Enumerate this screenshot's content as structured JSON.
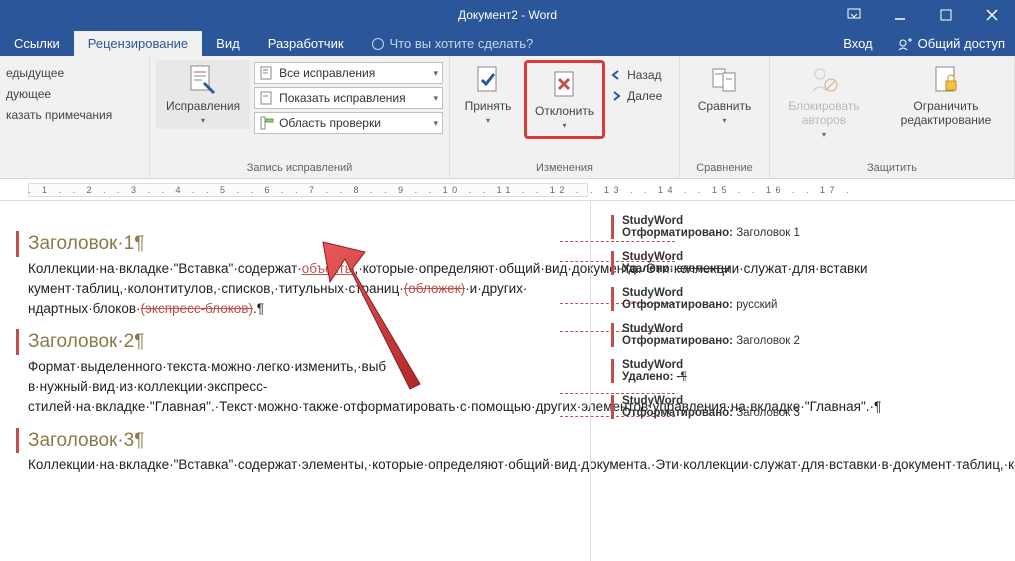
{
  "title": "Документ2 - Word",
  "tabs": {
    "references": "Ссылки",
    "review": "Рецензирование",
    "view": "Вид",
    "developer": "Разработчик",
    "tellme": "Что вы хотите сделать?",
    "login": "Вход",
    "share": "Общий доступ"
  },
  "ribbon": {
    "nav": {
      "prev": "едыдущее",
      "next": "дующее",
      "show_comments": "казать примечания"
    },
    "track": {
      "button": "Исправления",
      "display": "Все исправления",
      "show": "Показать исправления",
      "area": "Область проверки",
      "group": "Запись исправлений"
    },
    "changes": {
      "accept": "Принять",
      "reject": "Отклонить",
      "back": "Назад",
      "forward": "Далее",
      "group": "Изменения"
    },
    "compare": {
      "button": "Сравнить",
      "group": "Сравнение"
    },
    "protect": {
      "block": "Блокировать авторов",
      "restrict": "Ограничить редактирование",
      "group": "Защитить"
    }
  },
  "ruler": ". 1 . . 2 . . 3 . . 4 . . 5 . . 6 . . 7 . . 8 . . 9 . . 10 . . 11 . . 12 . . 13 . . 14 .   . 15 . . 16 . . 17 .",
  "doc": {
    "h1": "Заголовок·1¶",
    "p1a": "Коллекции·на·вкладке·\"Вставка\"·содержат·",
    "p1_ins": "объекты",
    "p1b": ",·которые·определяют·общий·вид·документа.·Эти·коллекции·служат·для·вставки",
    "p1c": "кумент·таблиц,·колонтитулов,·списков,·титульных·страниц·",
    "p1_del": "(обложек)",
    "p1d": "·и·других·      ндартных·блоков·",
    "p1_del2": "(экспресс-блоков)",
    "p1e": ".¶",
    "h2": "Заголовок·2¶",
    "p2": "Формат·выделенного·текста·можно·легко·изменить,·выб    в·нужный·вид·из·коллекции·экспресс-стилей·на·вкладке·\"Главная\".·Текст·можно·также·отформатировать·с·помощью·других·элементов·управления·на·вкладке·\"Главная\".·¶",
    "h3": "Заголовок·3¶",
    "p3": "Коллекции·на·вкладке·\"Вставка\"·содержат·элементы,·которые·определяют·общий·вид·документа.·Эти·коллекции·служат·для·вставки·в·документ·таблиц,·колонтитулов,·списков,·титульных·страниц·и·других·стандартных·блоков.¶"
  },
  "reviews": {
    "r1": {
      "author": "StudyWord",
      "label": "Отформатировано:",
      "val": "Заголовок 1"
    },
    "r2": {
      "author": "StudyWord",
      "label": "Удалено:",
      "val": "элементы"
    },
    "r3": {
      "author": "StudyWord",
      "label": "Отформатировано:",
      "val": "русский"
    },
    "r4": {
      "author": "StudyWord",
      "label": "Отформатировано:",
      "val": "Заголовок 2"
    },
    "r5": {
      "author": "StudyWord",
      "label": "Удалено:",
      "val": "·¶"
    },
    "r6": {
      "author": "StudyWord",
      "label": "Отформатировано:",
      "val": "Заголовок 3"
    }
  }
}
